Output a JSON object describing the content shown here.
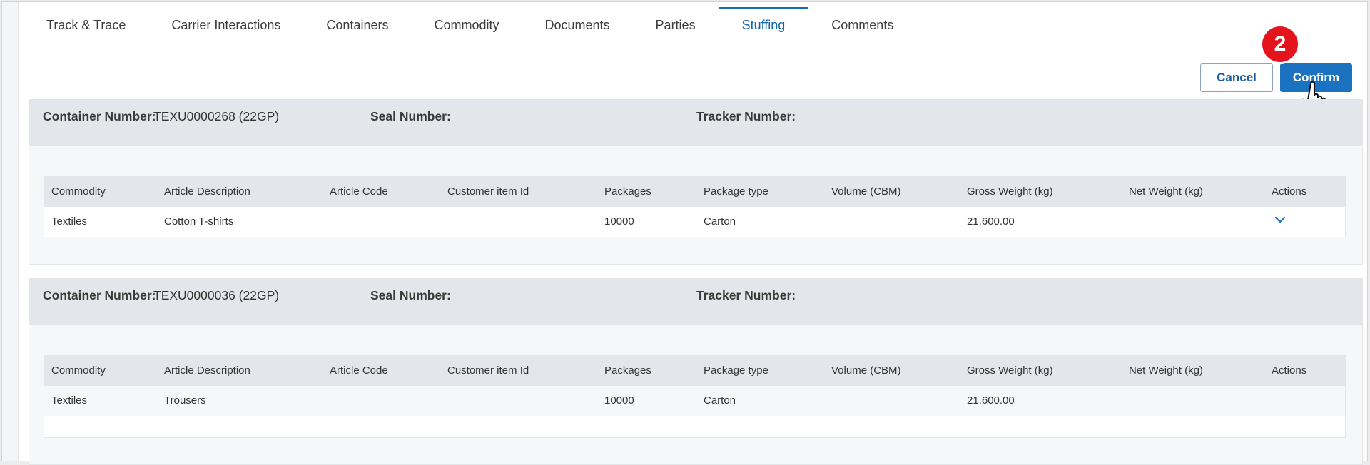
{
  "tabs": [
    {
      "label": "Track & Trace",
      "active": false
    },
    {
      "label": "Carrier Interactions",
      "active": false
    },
    {
      "label": "Containers",
      "active": false
    },
    {
      "label": "Commodity",
      "active": false
    },
    {
      "label": "Documents",
      "active": false
    },
    {
      "label": "Parties",
      "active": false
    },
    {
      "label": "Stuffing",
      "active": true
    },
    {
      "label": "Comments",
      "active": false
    }
  ],
  "actions": {
    "cancel_label": "Cancel",
    "confirm_label": "Confirm"
  },
  "step_badge": "2",
  "labels": {
    "container_number": "Container Number:",
    "seal_number": "Seal Number:",
    "tracker_number": "Tracker Number:"
  },
  "columns": [
    "Commodity",
    "Article Description",
    "Article Code",
    "Customer item Id",
    "Packages",
    "Package type",
    "Volume (CBM)",
    "Gross Weight (kg)",
    "Net Weight (kg)",
    "Actions"
  ],
  "containers": [
    {
      "container_number": "TEXU0000268 (22GP)",
      "seal_number": "",
      "tracker_number": "",
      "rows": [
        {
          "commodity": "Textiles",
          "article_description": "Cotton T-shirts",
          "article_code": "",
          "customer_item_id": "",
          "packages": "10000",
          "package_type": "Carton",
          "volume": "",
          "gross_weight": "21,600.00",
          "net_weight": "",
          "actions_icon": "chevron-down-icon"
        }
      ]
    },
    {
      "container_number": "TEXU0000036 (22GP)",
      "seal_number": "",
      "tracker_number": "",
      "rows": [
        {
          "commodity": "Textiles",
          "article_description": "Trousers",
          "article_code": "",
          "customer_item_id": "",
          "packages": "10000",
          "package_type": "Carton",
          "volume": "",
          "gross_weight": "21,600.00",
          "net_weight": "",
          "actions_icon": ""
        }
      ]
    }
  ],
  "colors": {
    "accent": "#1b72c0",
    "badge": "#e3141c",
    "header_bg": "#e3e6ea"
  }
}
